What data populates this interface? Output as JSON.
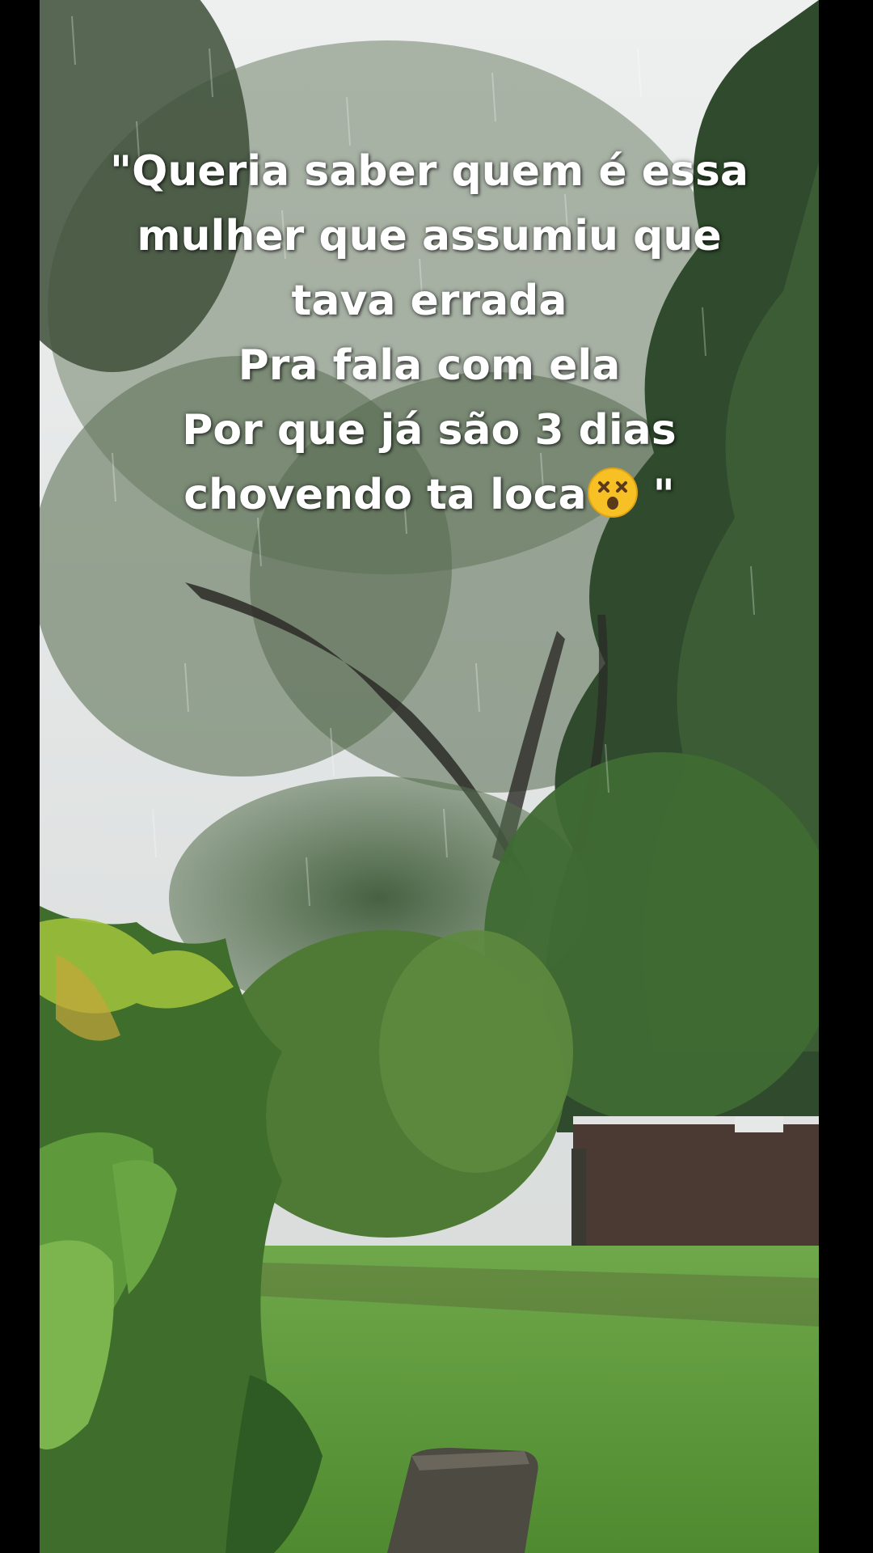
{
  "caption": {
    "lines": [
      "\"Queria saber quem é essa",
      "mulher que assumiu que",
      "tava errada",
      "Pra fala com ela",
      "Por que já são 3 dias",
      "chovendo ta loca"
    ],
    "closing_quote": " \"",
    "emoji": "dizzy-face-emoji"
  },
  "colors": {
    "sky": "#dfe2e2",
    "foliage_dark": "#2f4a2c",
    "foliage_mid": "#4f7440",
    "grass": "#5f9a3d",
    "fence": "#4a3a33",
    "text": "#ffffff"
  }
}
